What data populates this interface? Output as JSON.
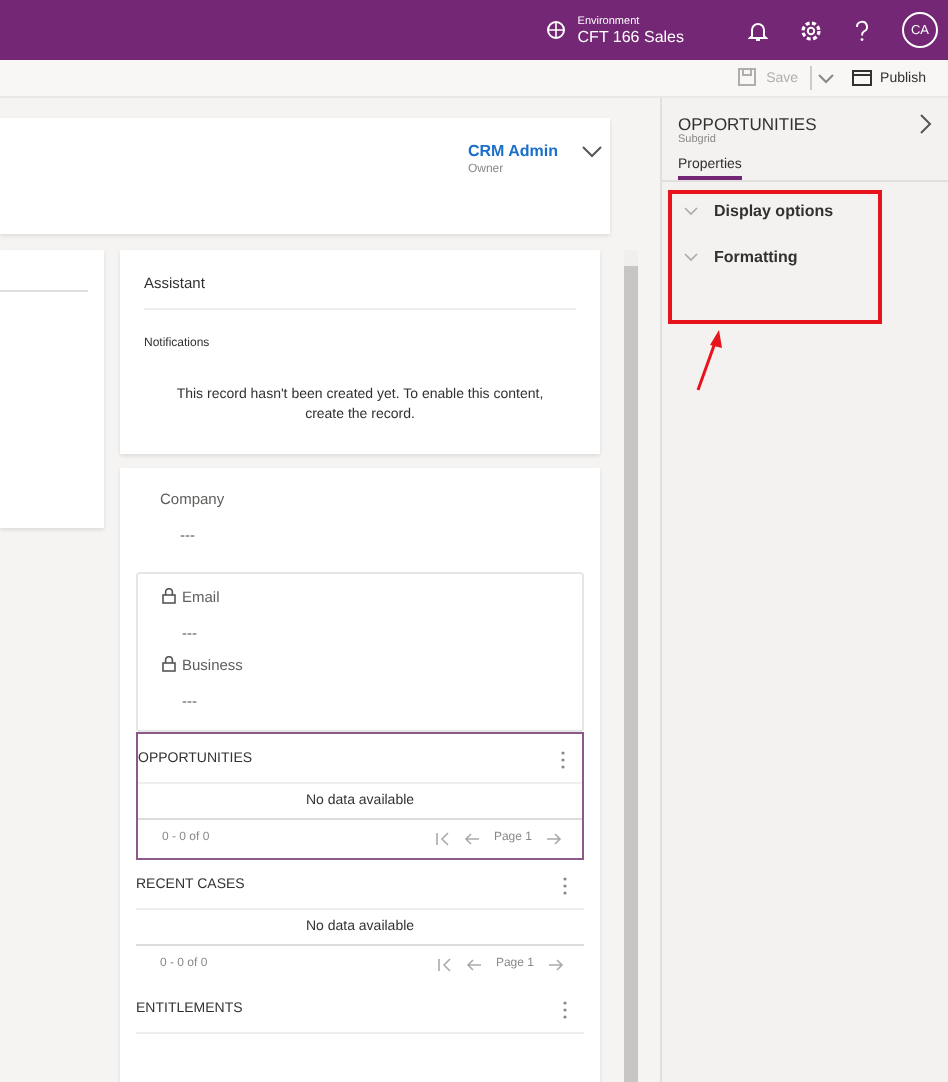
{
  "top_bar": {
    "environment_label": "Environment",
    "environment_name": "CFT 166 Sales",
    "avatar_initials": "CA"
  },
  "command_bar": {
    "buttons": [
      {
        "kind": "save",
        "label": "Save",
        "disabled": true
      },
      {
        "kind": "publish",
        "label": "Publish",
        "disabled": false
      }
    ]
  },
  "header": {
    "owner_name": "CRM Admin",
    "owner_label": "Owner"
  },
  "assistant": {
    "title": "Assistant",
    "section": "Notifications",
    "message": "This record hasn't been created yet. To enable this content, create the record."
  },
  "company": {
    "label": "Company",
    "value": "---",
    "locked": false
  },
  "contact_section": [
    {
      "label": "Email",
      "value": "---",
      "locked": true
    },
    {
      "label": "Business",
      "value": "---",
      "locked": true
    }
  ],
  "subgrids": [
    {
      "title": "OPPORTUNITIES",
      "selected": true,
      "empty_text": "No data available",
      "count": "0 - 0 of 0",
      "page": "Page 1"
    },
    {
      "title": "RECENT CASES",
      "selected": false,
      "empty_text": "No data available",
      "count": "0 - 0 of 0",
      "page": "Page 1"
    },
    {
      "title": "ENTITLEMENTS",
      "selected": false
    }
  ],
  "panel": {
    "title": "OPPORTUNITIES",
    "subtitle": "Subgrid",
    "tabs": [
      {
        "label": "Properties",
        "selected": true
      }
    ],
    "sections": [
      {
        "label": "Display options",
        "expanded": false
      },
      {
        "label": "Formatting",
        "expanded": false
      }
    ]
  }
}
